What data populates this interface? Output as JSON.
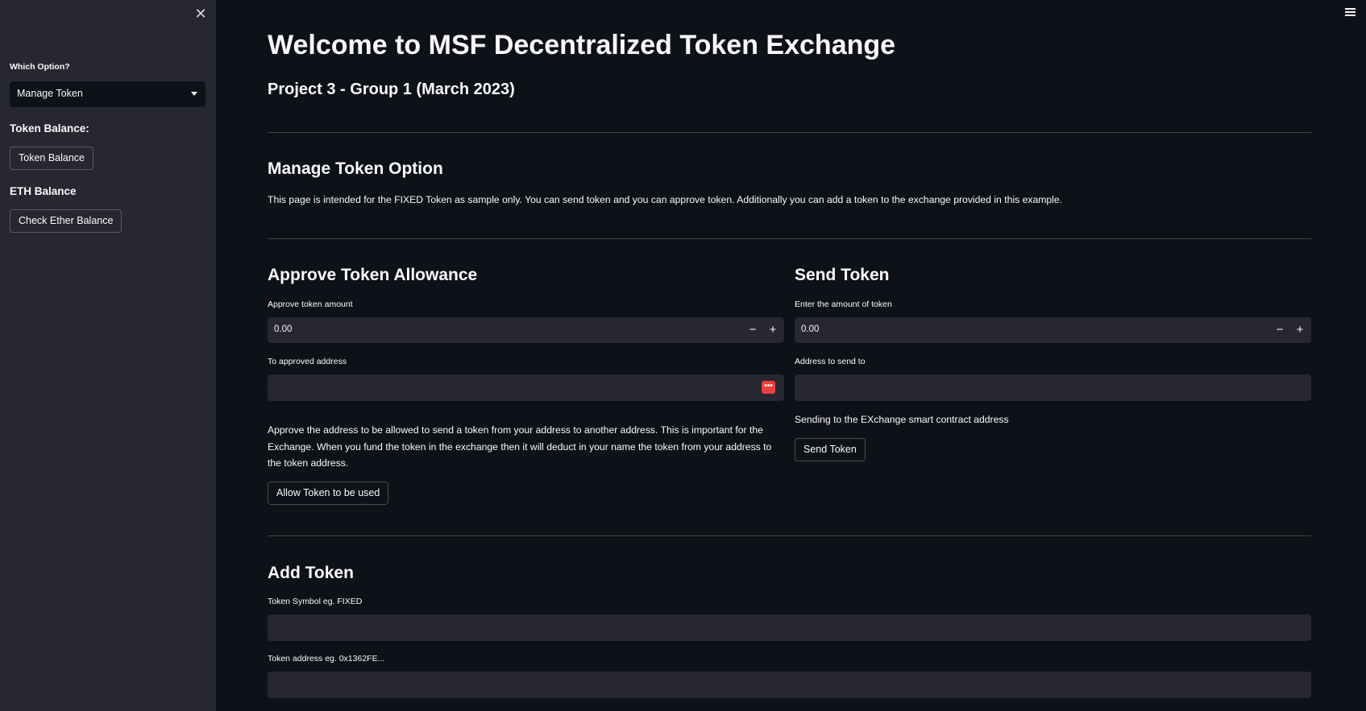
{
  "sidebar": {
    "close_icon": "close-icon",
    "select_label": "Which Option?",
    "select_value": "Manage Token",
    "token_balance_heading": "Token Balance:",
    "token_balance_button": "Token Balance",
    "eth_balance_heading": "ETH Balance",
    "check_ether_button": "Check Ether Balance"
  },
  "main": {
    "title": "Welcome to MSF Decentralized Token Exchange",
    "subtitle": "Project 3 - Group 1 (March 2023)",
    "manage_heading": "Manage Token Option",
    "manage_text": "This page is intended for the FIXED Token as sample only. You can send token and you can approve token. Additionally you can add a token to the exchange provided in this example.",
    "approve": {
      "heading": "Approve Token Allowance",
      "amount_label": "Approve token amount",
      "amount_value": "0.00",
      "address_label": "To approved address",
      "address_value": "",
      "badge": "•••",
      "description": "Approve the address to be allowed to send a token from your address to another address. This is important for the Exchange. When you fund the token in the exchange then it will deduct in your name the token from your address to the token address.",
      "button": "Allow Token to be used"
    },
    "send": {
      "heading": "Send Token",
      "amount_label": "Enter the amount of token",
      "amount_value": "0.00",
      "address_label": "Address to send to",
      "address_value": "",
      "note": "Sending to the EXchange smart contract address",
      "button": "Send Token"
    },
    "add": {
      "heading": "Add Token",
      "symbol_label": "Token Symbol eg. FIXED",
      "symbol_value": "",
      "address_label": "Token address eg. 0x1362FE...",
      "address_value": ""
    },
    "stepper_minus": "−",
    "stepper_plus": "+"
  },
  "colors": {
    "background": "#0e1117",
    "sidebar": "#262730",
    "input": "#262730",
    "text": "#fafafa",
    "badge": "#ee3f3f"
  },
  "icons": {
    "menu": "hamburger-menu-icon",
    "select_caret": "caret-down-icon"
  }
}
